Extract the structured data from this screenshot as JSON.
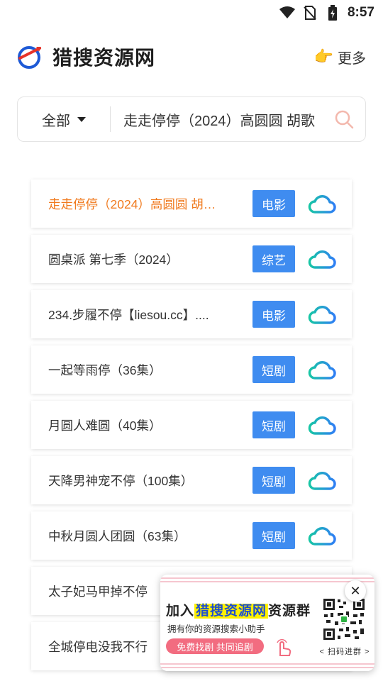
{
  "status_bar": {
    "time": "8:57"
  },
  "header": {
    "app_title": "猎搜资源网",
    "more_label": "更多",
    "more_icon": "👉"
  },
  "search": {
    "category": "全部",
    "query": "走走停停（2024）高圆圆 胡歌"
  },
  "results": [
    {
      "title": "走走停停（2024）高圆圆 胡…",
      "tag": "电影",
      "active": true
    },
    {
      "title": "圆桌派 第七季（2024）",
      "tag": "综艺",
      "active": false
    },
    {
      "title": "234.步履不停【liesou.cc】....",
      "tag": "电影",
      "active": false
    },
    {
      "title": "一起等雨停（36集）",
      "tag": "短剧",
      "active": false
    },
    {
      "title": "月圆人难圆（40集）",
      "tag": "短剧",
      "active": false
    },
    {
      "title": "天降男神宠不停（100集）",
      "tag": "短剧",
      "active": false
    },
    {
      "title": "中秋月圆人团圆（63集）",
      "tag": "短剧",
      "active": false
    },
    {
      "title": "太子妃马甲掉不停",
      "tag": "",
      "active": false
    },
    {
      "title": "全城停电没我不行",
      "tag": "",
      "active": false
    }
  ],
  "promo": {
    "title_prefix": "加入",
    "title_highlight": "猎搜资源网",
    "title_suffix": "资源群",
    "subtitle": "拥有你的资源搜索小助手",
    "button": "免费找剧 共同追剧",
    "scan_label": "< 扫码进群 >",
    "close": "✕"
  },
  "colors": {
    "accent": "#3f8cf0",
    "active_title": "#f07a1e",
    "promo_button": "#f26c80"
  }
}
